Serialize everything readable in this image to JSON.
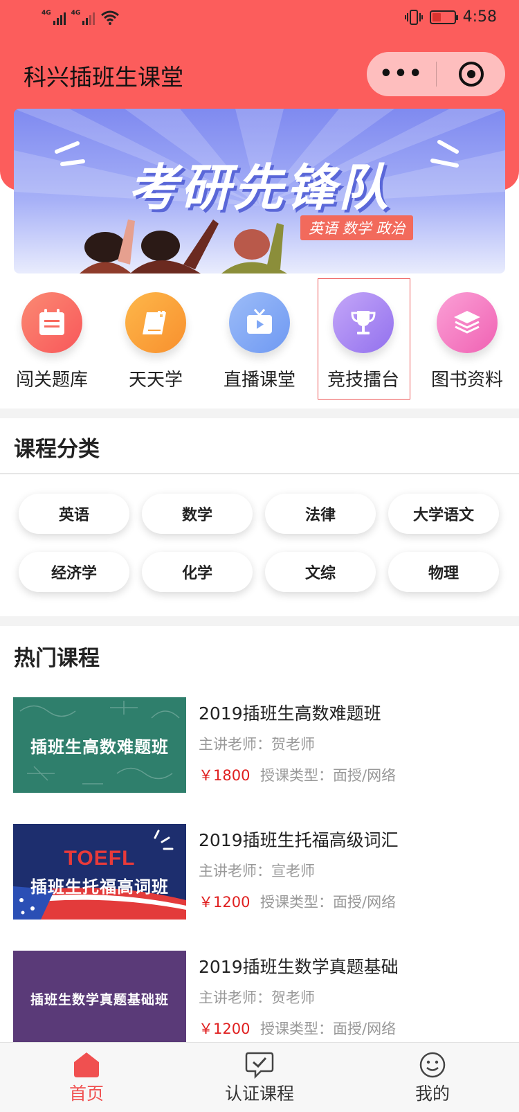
{
  "status_bar": {
    "signal_left": "4G",
    "signal_right": "4G",
    "time": "4:58"
  },
  "header": {
    "title": "科兴插班生课堂",
    "more_label": "•••"
  },
  "banner": {
    "title": "考研先锋队",
    "subtitle": "英语 数学 政治"
  },
  "categories": [
    {
      "label": "闯关题库",
      "icon": "calendar-icon",
      "color": "#f86a5f"
    },
    {
      "label": "天天学",
      "icon": "book-icon",
      "color": "#f9a23b"
    },
    {
      "label": "直播课堂",
      "icon": "tv-icon",
      "color": "#7fa7f5"
    },
    {
      "label": "竞技擂台",
      "icon": "trophy-icon",
      "color": "#a98af2"
    },
    {
      "label": "图书资料",
      "icon": "layers-icon",
      "color": "#f77fc6"
    }
  ],
  "course_categories": {
    "title": "课程分类",
    "items": [
      "英语",
      "数学",
      "法律",
      "大学语文",
      "经济学",
      "化学",
      "文综",
      "物理"
    ]
  },
  "hot_courses": {
    "title": "热门课程",
    "items": [
      {
        "title": "2019插班生高数难题班",
        "teacher": "主讲老师：贺老师",
        "price": "￥1800",
        "type": "授课类型：面授/网络",
        "thumb_text": "插班生高数难题班",
        "thumb_extra": ""
      },
      {
        "title": "2019插班生托福高级词汇",
        "teacher": "主讲老师：宣老师",
        "price": "￥1200",
        "type": "授课类型：面授/网络",
        "thumb_text": "插班生托福高词班",
        "thumb_extra": "TOEFL"
      },
      {
        "title": "2019插班生数学真题基础",
        "teacher": "主讲老师：贺老师",
        "price": "￥1200",
        "type": "授课类型：面授/网络",
        "thumb_text": "插班生数学真题基础班",
        "thumb_extra": ""
      }
    ]
  },
  "tabbar": {
    "items": [
      {
        "label": "首页",
        "icon": "home-icon",
        "active": true
      },
      {
        "label": "认证课程",
        "icon": "chat-check-icon",
        "active": false
      },
      {
        "label": "我的",
        "icon": "smile-icon",
        "active": false
      }
    ]
  },
  "colors": {
    "brand": "#fc5d5c",
    "price": "#e02020",
    "active_tab": "#f05050"
  }
}
